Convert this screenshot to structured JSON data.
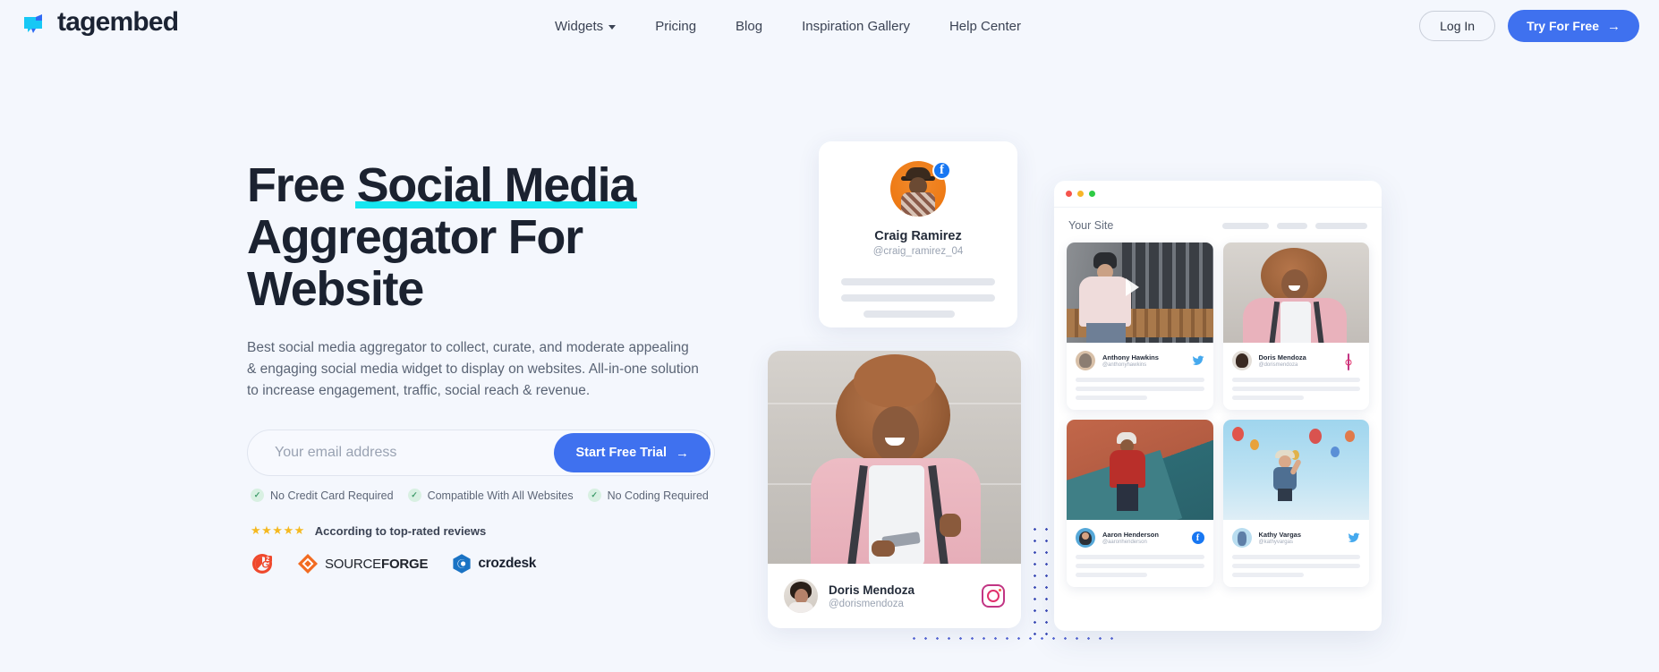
{
  "brand": {
    "name": "tagembed",
    "logo_icon": "tagembed-logo-icon"
  },
  "nav": {
    "items": [
      {
        "label": "Widgets",
        "has_dropdown": true
      },
      {
        "label": "Pricing",
        "has_dropdown": false
      },
      {
        "label": "Blog",
        "has_dropdown": false
      },
      {
        "label": "Inspiration Gallery",
        "has_dropdown": false
      },
      {
        "label": "Help Center",
        "has_dropdown": false
      }
    ],
    "login_label": "Log In",
    "cta_label": "Try For Free",
    "cta_arrow": "→"
  },
  "hero": {
    "title_part1": "Free ",
    "title_highlight": "Social Media",
    "title_part2": " Aggregator For Website",
    "highlight_color": "#16e6f0",
    "subtitle": "Best social media aggregator to collect, curate, and moderate appealing & engaging social media widget to display on websites. All-in-one solution to increase engagement, traffic, social reach & revenue.",
    "email_placeholder": "Your email address",
    "email_value": "",
    "submit_label": "Start Free Trial",
    "submit_arrow": "→",
    "accent_color": "#3f71ef",
    "features": [
      {
        "label": "No Credit Card Required",
        "icon": "check-icon"
      },
      {
        "label": "Compatible With All Websites",
        "icon": "check-icon"
      },
      {
        "label": "No Coding Required",
        "icon": "check-icon"
      }
    ],
    "reviews": {
      "stars": "★★★★★",
      "text": "According to top-rated reviews",
      "star_color": "#f5b920"
    },
    "review_logos": [
      {
        "name": "G2",
        "icon": "g2-logo-icon"
      },
      {
        "name": "SOURCEFORGE",
        "light": "SOURCE",
        "bold": "FORGE",
        "icon": "sourceforge-logo-icon"
      },
      {
        "name": "crozdesk",
        "icon": "crozdesk-logo-icon"
      }
    ]
  },
  "visual": {
    "profile_card": {
      "name": "Craig Ramirez",
      "handle": "@craig_ramirez_04",
      "platform": "facebook",
      "platform_icon": "facebook-icon",
      "badge_letter": "f"
    },
    "photo_card": {
      "name": "Doris Mendoza",
      "handle": "@dorismendoza",
      "platform": "instagram",
      "platform_icon": "instagram-icon"
    },
    "browser": {
      "site_label": "Your Site",
      "dots": [
        {
          "color": "#f5544c",
          "name": "close"
        },
        {
          "color": "#f7b528",
          "name": "minimize"
        },
        {
          "color": "#2ecb44",
          "name": "maximize"
        }
      ],
      "posts": [
        {
          "name": "Anthony Hawkins",
          "handle": "@anthonyhawkins",
          "platform": "twitter",
          "platform_icon": "twitter-icon",
          "has_play": true
        },
        {
          "name": "Doris Mendoza",
          "handle": "@dorismendoza",
          "platform": "instagram",
          "platform_icon": "instagram-icon",
          "has_play": false
        },
        {
          "name": "Aaron Henderson",
          "handle": "@aaronhenderson",
          "platform": "facebook",
          "platform_icon": "facebook-icon",
          "has_play": false
        },
        {
          "name": "Kathy Vargas",
          "handle": "@kathyvargas",
          "platform": "twitter",
          "platform_icon": "twitter-icon",
          "has_play": false
        }
      ]
    }
  }
}
